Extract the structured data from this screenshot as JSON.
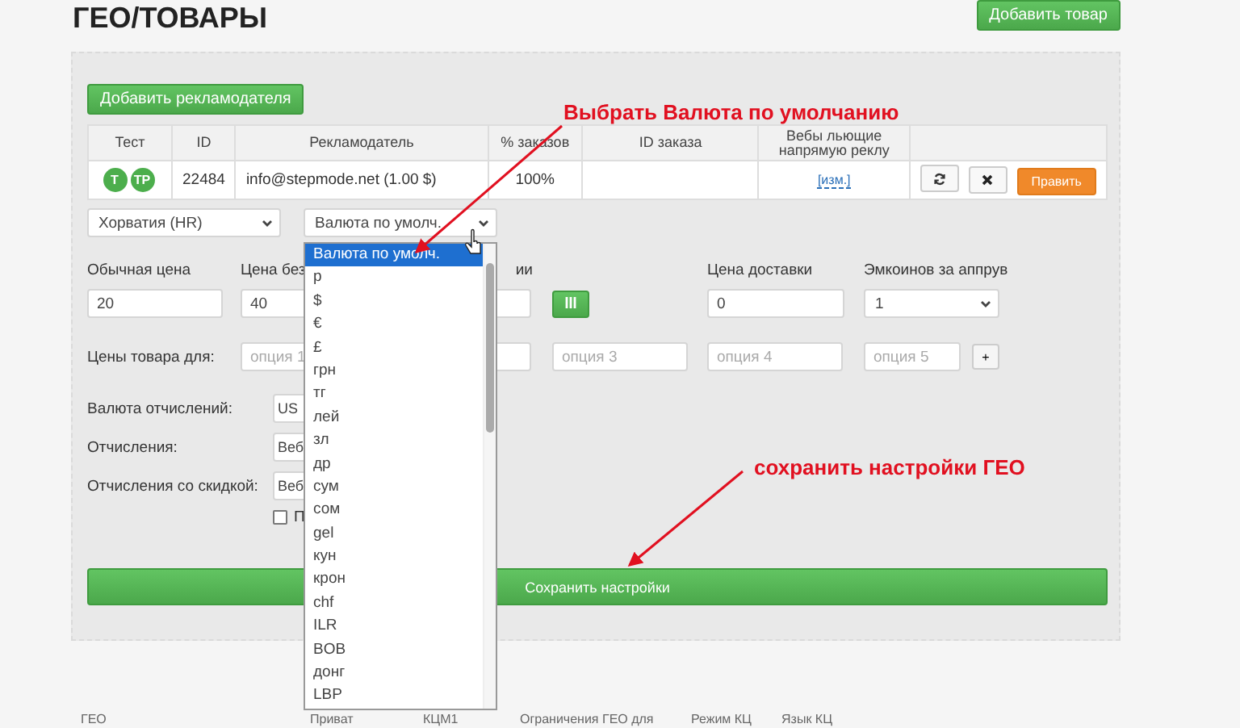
{
  "page_title": "ГЕО/ТОВАРЫ",
  "add_product_button": "Добавить товар",
  "add_advertiser_button": "Добавить рекламодателя",
  "table": {
    "columns": [
      "Тест",
      "ID",
      "Рекламодатель",
      "% заказов",
      "ID заказа",
      "Вебы льющие напрямую реклу",
      ""
    ],
    "rows": [
      {
        "badges": [
          "T",
          "TP"
        ],
        "id": "22484",
        "advertiser": "info@stepmode.net (1.00 $)",
        "percent": "100%",
        "order_id": "",
        "webs_link": "[изм.]",
        "edit_button": "Править"
      }
    ]
  },
  "country_select": "Хорватия (HR)",
  "currency_select": "Валюта по умолч.",
  "price_labels": [
    "Обычная цена",
    "Цена без",
    "ии",
    "Цена доставки",
    "Эмкоинов за аппрув"
  ],
  "price_values": [
    "20",
    "40",
    "0"
  ],
  "coins_select": "1",
  "option_label": "Цены товара для:",
  "option_placeholders": [
    "опция 1",
    "опция 3",
    "опция 4",
    "опция 5"
  ],
  "add_option_button": "+",
  "settings": [
    {
      "label": "Валюта отчислений:",
      "value": "US"
    },
    {
      "label": "Отчисления:",
      "value": "Веб"
    },
    {
      "label": "Отчисления со скидкой:",
      "value": "Веб"
    }
  ],
  "checkbox": {
    "label": "П",
    "checked": false
  },
  "save_button": "Сохранить настройки",
  "dropdown": [
    {
      "label": "Валюта по умолч.",
      "selected": true
    },
    {
      "label": "р",
      "selected": false
    },
    {
      "label": "$",
      "selected": false
    },
    {
      "label": "€",
      "selected": false
    },
    {
      "label": "£",
      "selected": false
    },
    {
      "label": "грн",
      "selected": false
    },
    {
      "label": "тг",
      "selected": false
    },
    {
      "label": "лей",
      "selected": false
    },
    {
      "label": "зл",
      "selected": false
    },
    {
      "label": "др",
      "selected": false
    },
    {
      "label": "сум",
      "selected": false
    },
    {
      "label": "сом",
      "selected": false
    },
    {
      "label": "gel",
      "selected": false
    },
    {
      "label": "кун",
      "selected": false
    },
    {
      "label": "крон",
      "selected": false
    },
    {
      "label": "chf",
      "selected": false
    },
    {
      "label": "ILR",
      "selected": false
    },
    {
      "label": "BOB",
      "selected": false
    },
    {
      "label": "донг",
      "selected": false
    },
    {
      "label": "LBP",
      "selected": false
    }
  ],
  "annotations": [
    "Выбрать Валюта по умолчанию",
    "сохранить настройки ГЕО"
  ],
  "bottom_columns": [
    "ГЕО",
    "Приват",
    "КЦМ1",
    "Ограничения ГЕО для",
    "Режим КЦ",
    "Язык КЦ"
  ]
}
